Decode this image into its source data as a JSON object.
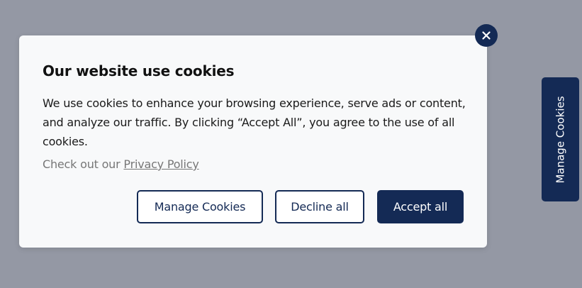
{
  "side_tab": {
    "label": "Manage Cookies"
  },
  "dialog": {
    "title": "Our website use cookies",
    "description": "We use cookies to enhance your browsing experience, serve ads or content, and analyze our traffic. By clicking “Accept All”, you agree to the use of all cookies.",
    "policy_prefix": "Check out our",
    "policy_link": "Privacy Policy",
    "buttons": {
      "manage": "Manage Cookies",
      "decline": "Decline all",
      "accept": "Accept all"
    },
    "close_icon": "close-icon"
  },
  "colors": {
    "backdrop": "#9498a4",
    "accent": "#142a55",
    "dialog_bg": "#f8f9fa"
  }
}
